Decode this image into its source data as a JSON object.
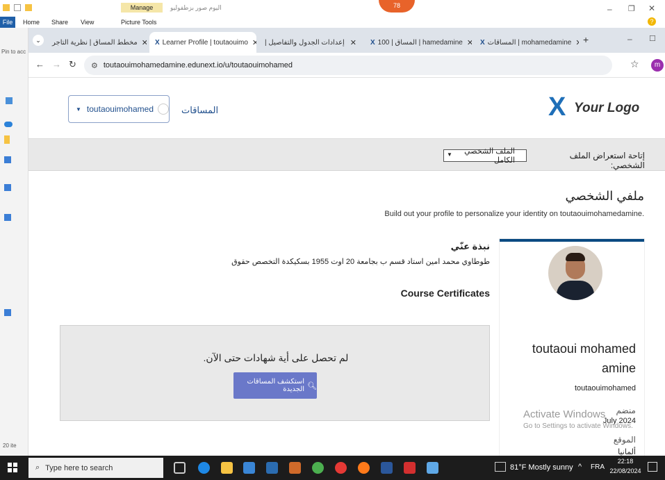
{
  "explorer": {
    "manage_label": "Manage",
    "picture_tools_label": "Picture Tools",
    "folder_title": "اليوم صور بزطفوليو",
    "ribbon_tabs": [
      "File",
      "Home",
      "Share",
      "View"
    ],
    "badge_number": "78",
    "sidebar_pin_text": "Pin to acc",
    "items_count": "20 ite"
  },
  "browser": {
    "tabs": [
      {
        "label": "مخطط المساق | نظرية التاجر"
      },
      {
        "label": "Learner Profile | toutaouimo"
      },
      {
        "label": "إعدادات الجدول والتفاصيل |"
      },
      {
        "label": "المساق | 100 | hamedamine"
      },
      {
        "label": "المساقات | mohamedamine"
      }
    ],
    "new_tab_label": "+",
    "url": "toutaouimohamedamine.edunext.io/u/toutaouimohamed",
    "profile_initial": "m"
  },
  "site": {
    "logo_text": "Your Logo",
    "courses_link": "المساقات",
    "username": "toutaouimohamed",
    "visibility_label": "إتاحة استعراض الملف الشخصي:",
    "visibility_value": "الملف الشخصي الكامل",
    "profile_heading": "ملفي الشخصي",
    "profile_subtitle": "Build out your profile to personalize your identity on toutaouimohamedamine.",
    "about_heading": "نبذة عنّي",
    "about_text": "طوطاوي محمد امين استاد قسم ب بجامعة 20 اوت 1955 بسكيكدة التخصص حقوق",
    "certs_heading": "Course Certificates",
    "no_certs_text": "لم تحصل على أية شهادات حتى الآن.",
    "explore_button": "استكشف المساقات الجديدة",
    "full_name": "toutaoui mohamed amine",
    "card_username": "toutaouimohamed",
    "joined_label": "منضم",
    "joined_date": "July 2024",
    "location_label": "الموقع",
    "location_value": "ألمانيا"
  },
  "watermark": {
    "line1": "Activate Windows",
    "line2": "Go to Settings to activate Windows."
  },
  "taskbar": {
    "search_placeholder": "Type here to search",
    "weather": "81°F  Mostly sunny",
    "lang": "FRA",
    "time": "22:18",
    "date": "22/08/2024"
  },
  "colors": {
    "brand_blue": "#0a4a82",
    "button_purple": "#6a78c9"
  }
}
